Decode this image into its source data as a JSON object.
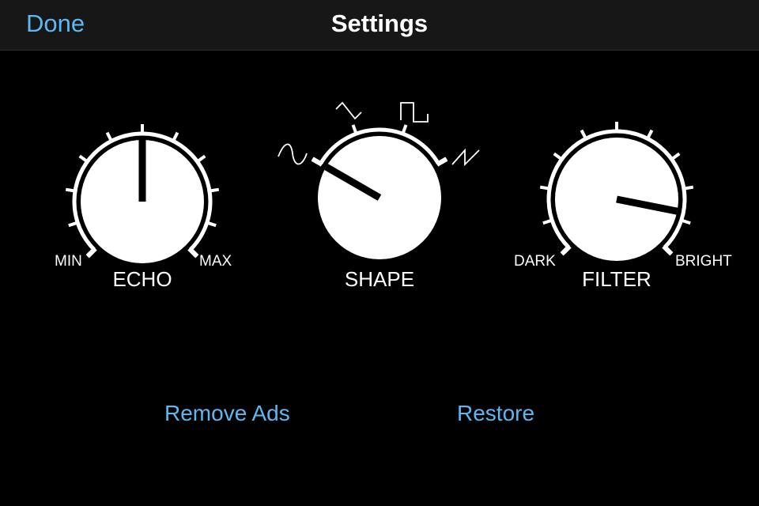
{
  "navbar": {
    "done_label": "Done",
    "title": "Settings"
  },
  "knobs": [
    {
      "name": "ECHO",
      "min_label": "MIN",
      "max_label": "MAX",
      "level": 0.5
    },
    {
      "name": "SHAPE",
      "options": [
        "sine",
        "triangle",
        "square",
        "sawtooth"
      ],
      "level": 0.0
    },
    {
      "name": "FILTER",
      "min_label": "DARK",
      "max_label": "BRIGHT",
      "level": 0.875
    }
  ],
  "actions": {
    "remove_ads_label": "Remove Ads",
    "restore_label": "Restore"
  },
  "colors": {
    "accent": "#5db8f2",
    "background": "#000000",
    "navbar": "#171717",
    "knob": "#ffffff",
    "pointer": "#000000"
  }
}
